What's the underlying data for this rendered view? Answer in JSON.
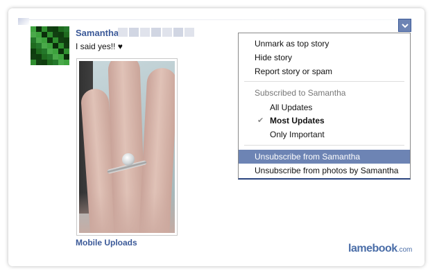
{
  "post": {
    "author_name": "Samantha",
    "status_text": "I said yes!! ♥",
    "photo_caption": "Mobile Uploads"
  },
  "menu": {
    "items": {
      "unmark_top_story": "Unmark as top story",
      "hide_story": "Hide story",
      "report": "Report story or spam",
      "subscribed_header": "Subscribed to Samantha",
      "all_updates": "All Updates",
      "most_updates": "Most Updates",
      "only_important": "Only Important",
      "unsubscribe": "Unsubscribe from Samantha",
      "unsubscribe_photos": "Unsubscribe from photos by Samantha"
    },
    "selected_option": "Most Updates",
    "checkmark": "✔",
    "highlighted_item": "Unsubscribe from Samantha"
  },
  "watermark": {
    "main": "lamebook",
    "suffix": ".com"
  },
  "icons": {
    "dropdown": "chevron-down-icon",
    "check": "check-icon"
  },
  "colors": {
    "link_blue": "#3b5998",
    "menu_highlight": "#6d84b4",
    "watermark": "#4b6ea8"
  }
}
